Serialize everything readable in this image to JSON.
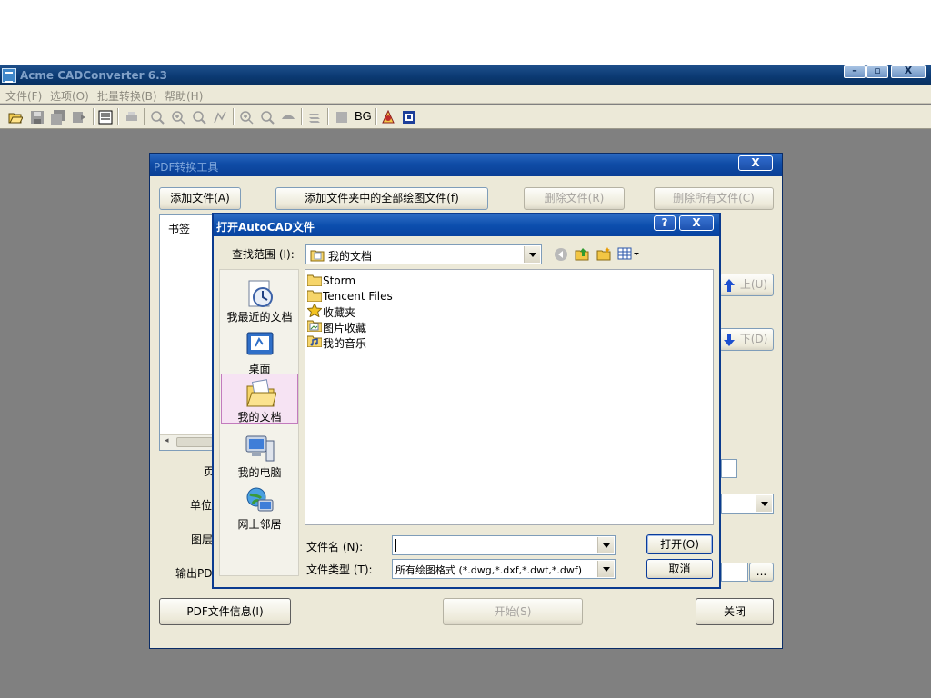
{
  "app": {
    "title": "Acme CADConverter 6.3",
    "menu": [
      "文件(F)",
      "选项(O)",
      "批量转换(B)",
      "帮助(H)"
    ],
    "toolbar_bg_label": "BG",
    "window_controls": {
      "minimize": "–",
      "restore": "▫",
      "close": "X"
    }
  },
  "pdf_dialog": {
    "title": "PDF转换工具",
    "close": "X",
    "buttons": {
      "add_file": "添加文件(A)",
      "add_folder": "添加文件夹中的全部绘图文件(f)",
      "delete_file": "删除文件(R)",
      "delete_all": "删除所有文件(C)",
      "up": "上(U)",
      "down": "下(D)",
      "pdf_info": "PDF文件信息(I)",
      "start": "开始(S)",
      "close": "关闭",
      "browse": "..."
    },
    "bookmark_header": "书签",
    "labels": {
      "page": "页",
      "unit": "单位",
      "layer": "图层",
      "output": "输出PD"
    }
  },
  "open_dialog": {
    "title": "打开AutoCAD文件",
    "help": "?",
    "close": "X",
    "look_in_label": "查找范围 (I):",
    "look_in_value": "我的文档",
    "places": [
      "我最近的文档",
      "桌面",
      "我的文档",
      "我的电脑",
      "网上邻居"
    ],
    "selected_place": "我的文档",
    "files": [
      {
        "name": "Storm",
        "icon": "folder-icon"
      },
      {
        "name": "Tencent Files",
        "icon": "folder-icon"
      },
      {
        "name": "收藏夹",
        "icon": "star-folder-icon"
      },
      {
        "name": "图片收藏",
        "icon": "pictures-folder-icon"
      },
      {
        "name": "我的音乐",
        "icon": "music-folder-icon"
      }
    ],
    "filename_label": "文件名 (N):",
    "filename_value": "",
    "filetype_label": "文件类型 (T):",
    "filetype_value": "所有绘图格式 (*.dwg,*.dxf,*.dwt,*.dwf)",
    "open_button": "打开(O)",
    "cancel_button": "取消"
  }
}
